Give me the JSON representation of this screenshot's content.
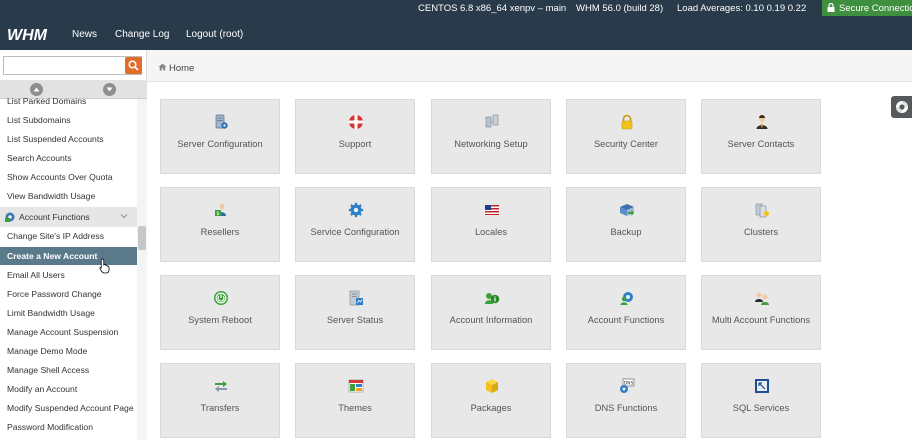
{
  "topbar": {
    "os_info": "CENTOS 6.8 x86_64 xenpv – main",
    "whm_version": "WHM 56.0 (build 28)",
    "load_averages": "Load Averages: 0.10 0.19 0.22",
    "secure_connection": "Secure Connection",
    "logo_text": "WHM",
    "nav": [
      "News",
      "Change Log",
      "Logout (root)"
    ]
  },
  "sidebar": {
    "search": {
      "value": "",
      "placeholder": ""
    },
    "items_before": [
      "List Parked Domains",
      "List Subdomains",
      "List Suspended Accounts",
      "Search Accounts",
      "Show Accounts Over Quota",
      "View Bandwidth Usage"
    ],
    "section": "Account Functions",
    "items_after": [
      "Change Site's IP Address",
      "Create a New Account",
      "Email All Users",
      "Force Password Change",
      "Limit Bandwidth Usage",
      "Manage Account Suspension",
      "Manage Demo Mode",
      "Manage Shell Access",
      "Modify an Account",
      "Modify Suspended Account Page",
      "Password Modification"
    ],
    "active_item": "Create a New Account"
  },
  "breadcrumb": {
    "home": "Home"
  },
  "tiles": [
    [
      "Server Configuration",
      "Support",
      "Networking Setup",
      "Security Center",
      "Server Contacts"
    ],
    [
      "Resellers",
      "Service Configuration",
      "Locales",
      "Backup",
      "Clusters"
    ],
    [
      "System Reboot",
      "Server Status",
      "Account Information",
      "Account Functions",
      "Multi Account Functions"
    ],
    [
      "Transfers",
      "Themes",
      "Packages",
      "DNS Functions",
      "SQL Services"
    ]
  ],
  "icons": [
    [
      "server-config-icon",
      "lifebuoy-icon",
      "network-icon",
      "padlock-icon",
      "contact-person-icon"
    ],
    [
      "reseller-icon",
      "service-gear-icon",
      "flag-icon",
      "backup-drive-icon",
      "cluster-servers-icon"
    ],
    [
      "power-icon",
      "server-status-icon",
      "account-info-icon",
      "account-gear-icon",
      "multi-account-icon"
    ],
    [
      "transfer-icon",
      "palette-icon",
      "package-box-icon",
      "dns-icon",
      "database-icon"
    ]
  ],
  "colors": {
    "topbar": "#293a4a",
    "secure_green": "#3e8f3e",
    "search_button": "#e26c2c",
    "active_menu": "#5a7a8c",
    "tile_bg": "#e8e8e8"
  }
}
